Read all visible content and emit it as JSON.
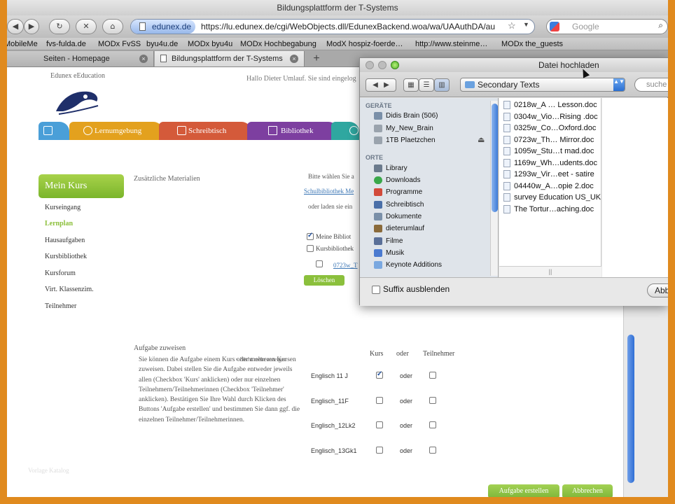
{
  "browser": {
    "window_title": "Bildungsplattform der T-Systems",
    "url_domain": "edunex.de",
    "url": "https://lu.edunex.de/cgi/WebObjects.dll/EdunexBackend.woa/wa/UAAuthDA/auth?par",
    "search_placeholder": "Google",
    "nav": {
      "back": "◀",
      "forward": "▶",
      "reload": "↻",
      "stop": "✕",
      "home": "⌂",
      "star": "☆",
      "dropdown": "▼",
      "search_icon": "⌕"
    },
    "bookmarks": [
      "MobileMe",
      "fvs-fulda.de",
      "MODx FvSS",
      "byu4u.de",
      "MODx byu4u",
      "MODx Hochbegabung",
      "ModX hospiz-foerde…",
      "http://www.steinme…",
      "MODx the_guests"
    ],
    "tabs": [
      {
        "label": "Seiten - Homepage",
        "active": false
      },
      {
        "label": "Bildungsplattform der T-Systems",
        "active": true
      }
    ],
    "new_tab": "+",
    "tab_close": "×"
  },
  "site": {
    "logo_text": "Edunex eEducation",
    "greeting": "Hallo Dieter Umlauf. Sie sind eingelog",
    "nav_tabs": [
      {
        "label": "",
        "color": "#4a9fd8",
        "icon": "home-icon"
      },
      {
        "label": "Lernumgebung",
        "color": "#e3a11e",
        "icon": "globe-icon"
      },
      {
        "label": "Schreibtisch",
        "color": "#d45a3a",
        "icon": "monitor-icon"
      },
      {
        "label": "Bibliothek",
        "color": "#7d3fa0",
        "icon": "books-icon"
      },
      {
        "label": "",
        "color": "#2fa7a0",
        "icon": "gear-icon"
      }
    ],
    "course_title": "Mein Kurs",
    "sidebar": [
      "Kurseingang",
      "Lernplan",
      "Hausaufgaben",
      "Kursbibliothek",
      "Kursforum",
      "Virt. Klassenzim.",
      "Teilnehmer"
    ],
    "sidebar_active": "Lernplan",
    "zusatz": "Zusätzliche Materialien",
    "bitte": "Bitte wählen Sie a",
    "schulbib_link": "Schulbibliothek Me",
    "oder_laden": "oder laden sie ein",
    "meine_bib": "Meine Bibliot",
    "kursbib": "Kursbibliothek",
    "file_link": "0723w_T",
    "loeschen": "Löschen",
    "aufgabe_title": "Aufgabe zuweisen",
    "nicht_mehr": "Nicht mehr anzeigen",
    "aufgabe_text": "Sie können die Aufgabe einem Kurs oder mehreren Kursen zuweisen. Dabei stellen Sie die Aufgabe entweder jeweils allen (Checkbox 'Kurs' anklicken) oder nur einzelnen Teilnehmern/Teilnehmerinnen (Checkbox 'Teilnehmer' anklicken). Bestätigen Sie Ihre Wahl durch Klicken des Buttons 'Aufgabe erstellen' und bestimmen Sie dann ggf. die einzelnen Teilnehmer/Teilnehmerinnen.",
    "columns": {
      "kurs": "Kurs",
      "oder": "oder",
      "teilnehmer": "Teilnehmer"
    },
    "rows": [
      {
        "label": "Englisch 11 J",
        "kurs": true,
        "teilnehmer": false
      },
      {
        "label": "Englisch_11F",
        "kurs": false,
        "teilnehmer": false
      },
      {
        "label": "Englisch_12Lk2",
        "kurs": false,
        "teilnehmer": false
      },
      {
        "label": "Englisch_13Gk1",
        "kurs": false,
        "teilnehmer": false
      }
    ],
    "row_oder": "oder",
    "btn_create": "Aufgabe erstellen",
    "btn_cancel": "Abbrechen",
    "watermark": "Vorlage Katalog"
  },
  "dialog": {
    "title": "Datei hochladen",
    "folder": "Secondary Texts",
    "search_placeholder": "suche",
    "section_devices": "GERÄTE",
    "devices": [
      {
        "label": "Didis Brain (506)",
        "icon": "computer-icon",
        "color": "#7a8fa8"
      },
      {
        "label": "My_New_Brain",
        "icon": "disk-icon",
        "color": "#9aa3ad"
      },
      {
        "label": "1TB Plaetzchen",
        "icon": "disk-icon",
        "color": "#9aa3ad"
      }
    ],
    "section_places": "ORTE",
    "places": [
      {
        "label": "Library",
        "icon": "library-icon",
        "color": "#6b7a8c"
      },
      {
        "label": "Downloads",
        "icon": "downloads-icon",
        "color": "#3aa84a"
      },
      {
        "label": "Programme",
        "icon": "applications-icon",
        "color": "#d24a3a"
      },
      {
        "label": "Schreibtisch",
        "icon": "desktop-icon",
        "color": "#4a6fa8"
      },
      {
        "label": "Dokumente",
        "icon": "documents-icon",
        "color": "#7a8fa8"
      },
      {
        "label": "dieterumlauf",
        "icon": "home-icon",
        "color": "#8a6a3a"
      },
      {
        "label": "Filme",
        "icon": "movies-icon",
        "color": "#5a6f98"
      },
      {
        "label": "Musik",
        "icon": "music-icon",
        "color": "#4a7ad0"
      },
      {
        "label": "Keynote Additions",
        "icon": "folder-icon",
        "color": "#7aa8e0"
      }
    ],
    "files": [
      "0218w_A … Lesson.doc",
      "0304w_Vio…Rising .doc",
      "0325w_Co…Oxford.doc",
      "0723w_Th… Mirror.doc",
      "1095w_Stu…t mad.doc",
      "1169w_Wh…udents.doc",
      "1293w_Vir…eet - satire",
      "04440w_A…opie 2.doc",
      "survey Education US_UK",
      "The Tortur…aching.doc"
    ],
    "suffix_label": "Suffix ausblenden",
    "cancel": "Abbrechen",
    "scroll_grip": "||",
    "view_icons": {
      "icon_view": "▦",
      "list_view": "☰",
      "column_view": "▥"
    },
    "popup_arrows": "▲▼",
    "search_icon": "⌕",
    "eject": "⏏"
  }
}
